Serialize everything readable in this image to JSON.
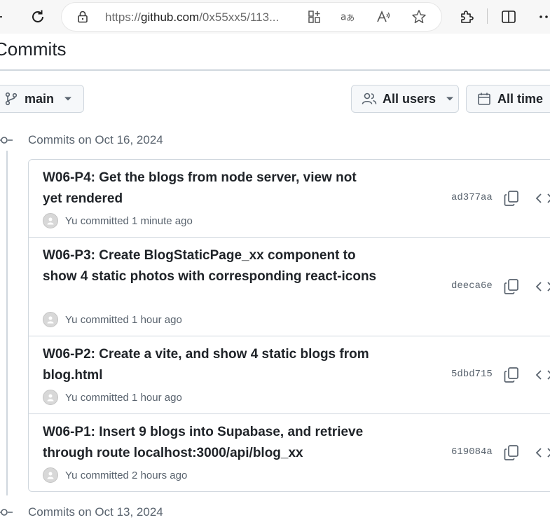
{
  "browser": {
    "url_prefix": "https://",
    "url_domain": "github.com",
    "url_rest": "/0x55xx5/113...",
    "icons": [
      "back-icon",
      "reload-icon",
      "lock-icon",
      "app-grid-icon",
      "translate-icon",
      "read-aloud-icon",
      "favorite-star-icon",
      "extensions-icon",
      "split-screen-icon",
      "more-icon"
    ]
  },
  "page": {
    "title": "Commits"
  },
  "filters": {
    "branch": "main",
    "users": "All users",
    "time": "All time"
  },
  "groups": [
    {
      "heading": "Commits on Oct 16, 2024"
    },
    {
      "heading": "Commits on Oct 13, 2024"
    }
  ],
  "commits": [
    {
      "message": "W06-P4: Get the blogs from node server, view not yet rendered",
      "author": "Yu",
      "when": "committed 1 minute ago",
      "sha": "ad377aa"
    },
    {
      "message": "W06-P3: Create BlogStaticPage_xx component to show 4 static photos with corresponding react-icons",
      "author": "Yu",
      "when": "committed 1 hour ago",
      "sha": "deeca6e"
    },
    {
      "message": "W06-P2: Create a vite, and show 4 static blogs from blog.html",
      "author": "Yu",
      "when": "committed 1 hour ago",
      "sha": "5dbd715"
    },
    {
      "message": "W06-P1: Insert 9 blogs into Supabase, and retrieve through route localhost:3000/api/blog_xx",
      "author": "Yu",
      "when": "committed 2 hours ago",
      "sha": "619084a"
    }
  ],
  "colors": {
    "border": "#d0d7de",
    "muted_text": "#59636e",
    "button_bg": "#f6f8fa"
  }
}
